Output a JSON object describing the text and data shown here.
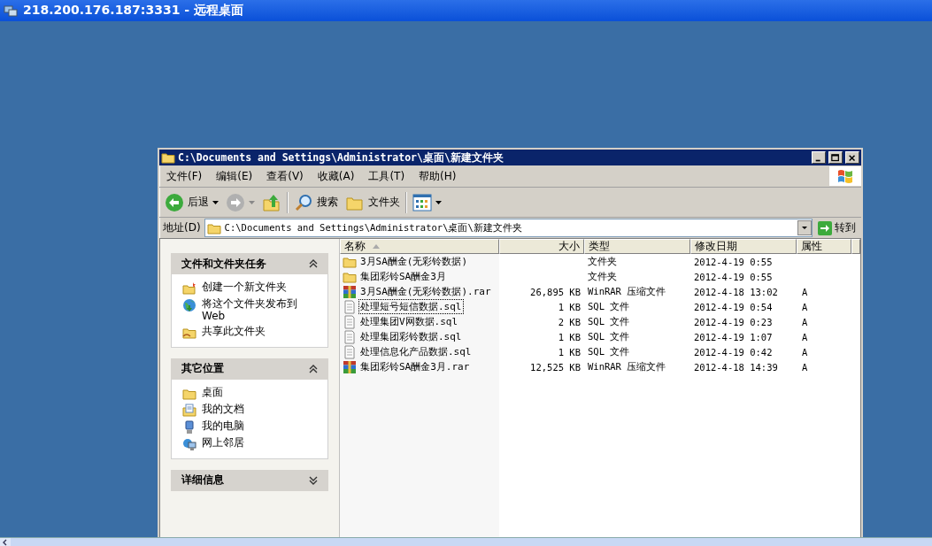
{
  "remote_title": "218.200.176.187:3331 - 远程桌面",
  "window": {
    "title": "C:\\Documents and Settings\\Administrator\\桌面\\新建文件夹"
  },
  "menu": [
    "文件(F)",
    "编辑(E)",
    "查看(V)",
    "收藏(A)",
    "工具(T)",
    "帮助(H)"
  ],
  "toolbar": {
    "back": "后退",
    "search": "搜索",
    "folders": "文件夹"
  },
  "address": {
    "label": "地址(D)",
    "value": "C:\\Documents and Settings\\Administrator\\桌面\\新建文件夹",
    "go": "转到"
  },
  "panels": [
    {
      "title": "文件和文件夹任务",
      "expanded": true,
      "items": [
        {
          "kind": "new-folder",
          "label": "创建一个新文件夹"
        },
        {
          "kind": "publish",
          "label": "将这个文件夹发布到 Web"
        },
        {
          "kind": "share",
          "label": "共享此文件夹"
        }
      ]
    },
    {
      "title": "其它位置",
      "expanded": true,
      "items": [
        {
          "kind": "folder",
          "label": "桌面"
        },
        {
          "kind": "documents",
          "label": "我的文档"
        },
        {
          "kind": "computer",
          "label": "我的电脑"
        },
        {
          "kind": "network",
          "label": "网上邻居"
        }
      ]
    },
    {
      "title": "详细信息",
      "expanded": false
    }
  ],
  "table": {
    "columns": [
      {
        "label": "名称",
        "sorted": true
      },
      {
        "label": "大小",
        "sorted": false
      },
      {
        "label": "类型",
        "sorted": false
      },
      {
        "label": "修改日期",
        "sorted": false
      },
      {
        "label": "属性",
        "sorted": false
      }
    ],
    "rows": [
      {
        "kind": "folder",
        "name": "3月SA酬金(无彩铃数据)",
        "type": "文件夹",
        "date": "2012-4-19 0:55",
        "focused": false
      },
      {
        "kind": "folder",
        "name": "集团彩铃SA酬金3月",
        "type": "文件夹",
        "date": "2012-4-19 0:55",
        "focused": false
      },
      {
        "kind": "rar",
        "name": "3月SA酬金(无彩铃数据).rar",
        "size": "26,895 KB",
        "type": "WinRAR 压缩文件",
        "date": "2012-4-18 13:02",
        "attr": "A",
        "focused": false
      },
      {
        "kind": "sql",
        "name": "处理短号短信数据.sql",
        "size": "1 KB",
        "type": "SQL 文件",
        "date": "2012-4-19 0:54",
        "attr": "A",
        "focused": true
      },
      {
        "kind": "sql",
        "name": "处理集团V网数据.sql",
        "size": "2 KB",
        "type": "SQL 文件",
        "date": "2012-4-19 0:23",
        "attr": "A",
        "focused": false
      },
      {
        "kind": "sql",
        "name": "处理集团彩铃数据.sql",
        "size": "1 KB",
        "type": "SQL 文件",
        "date": "2012-4-19 1:07",
        "attr": "A",
        "focused": false
      },
      {
        "kind": "sql",
        "name": "处理信息化产品数据.sql",
        "size": "1 KB",
        "type": "SQL 文件",
        "date": "2012-4-19 0:42",
        "attr": "A",
        "focused": false
      },
      {
        "kind": "rar",
        "name": "集团彩铃SA酬金3月.rar",
        "size": "12,525 KB",
        "type": "WinRAR 压缩文件",
        "date": "2012-4-18 14:39",
        "attr": "A",
        "focused": false
      }
    ]
  }
}
